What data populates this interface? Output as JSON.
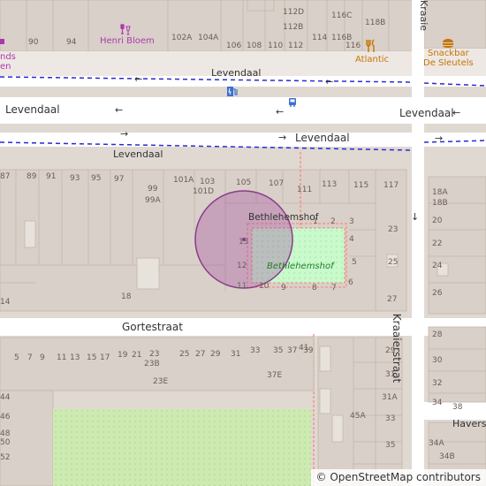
{
  "streets": {
    "levendaal_top": "Levendaal",
    "levendaal_right": "Levendaal",
    "levendaal_center": "Levendaal",
    "levendaal_lower": "Levendaal",
    "gortestraat": "Gortestraat",
    "kraaierstraat": "Kraaierstraat",
    "kraaie_top": "Kraaie",
    "haverstraat": "Haverstra"
  },
  "pois": {
    "henri_bloem": "Henri Bloem",
    "snackbar": "Snackbar De Sleutels",
    "snackbar_line1": "Snackbar",
    "snackbar_line2": "De Sleutels",
    "atlantic": "Atlantic",
    "left_cut_1": "nds",
    "left_cut_2": "en"
  },
  "places": {
    "building": "Bethlehemshof",
    "park": "Bethlehemshof"
  },
  "house_numbers": {
    "n112D": "112D",
    "n112B": "112B",
    "n116C": "116C",
    "n116B": "116B",
    "n118B": "118B",
    "n90": "90",
    "n94": "94",
    "n102A": "102A",
    "n104A": "104A",
    "n106": "106",
    "n108": "108",
    "n110": "110",
    "n112": "112",
    "n114": "114",
    "n116": "116",
    "n87": "87",
    "n89": "89",
    "n91": "91",
    "n93": "93",
    "n95": "95",
    "n97": "97",
    "n99": "99",
    "n99A": "99A",
    "n101A": "101A",
    "n103": "103",
    "n101D": "101D",
    "n105": "105",
    "n107": "107",
    "n111": "111",
    "n113": "113",
    "n115": "115",
    "n117": "117",
    "n1": "1",
    "n2": "2",
    "n3": "3",
    "n4": "4",
    "n5": "5",
    "n6": "6",
    "n7": "7",
    "n8": "8",
    "n9": "9",
    "n10": "10",
    "n11": "11",
    "n12": "12",
    "n13": "13",
    "n23": "23",
    "n25": "25",
    "n27": "27",
    "n18": "18",
    "n14": "14",
    "n18A": "18A",
    "n18B": "18B",
    "n20": "20",
    "n22": "22",
    "n24": "24",
    "n26": "26",
    "r28": "28",
    "r30": "30",
    "r32": "32",
    "r34": "34",
    "r38": "38",
    "g5": "5",
    "g7": "7",
    "g9": "9",
    "g11": "11",
    "g13": "13",
    "g15": "15",
    "g17": "17",
    "g19": "19",
    "g21": "21",
    "g23": "23",
    "g23B": "23B",
    "g25": "25",
    "g27": "27",
    "g29": "29",
    "g31": "31",
    "g33": "33",
    "g35": "35",
    "g37": "37",
    "g39": "39",
    "g41": "41",
    "g23E": "23E",
    "g37E": "37E",
    "k29": "29",
    "k31": "31",
    "k31A": "31A",
    "k33": "33",
    "k35": "35",
    "k45A": "45A",
    "k34A": "34A",
    "k34B": "34B",
    "lh44": "44",
    "lh46": "46",
    "lh48": "48",
    "lh50": "50",
    "lh52": "52"
  },
  "attribution": "© OpenStreetMap contributors",
  "colors": {
    "road": "#ffffff",
    "block": "#e0d9d2",
    "building": "#d9d0c9",
    "park": "#c8facc",
    "bus_route": "#2a2ad6",
    "highlight_circle": "#a040a0",
    "footway": "#fa8072"
  }
}
